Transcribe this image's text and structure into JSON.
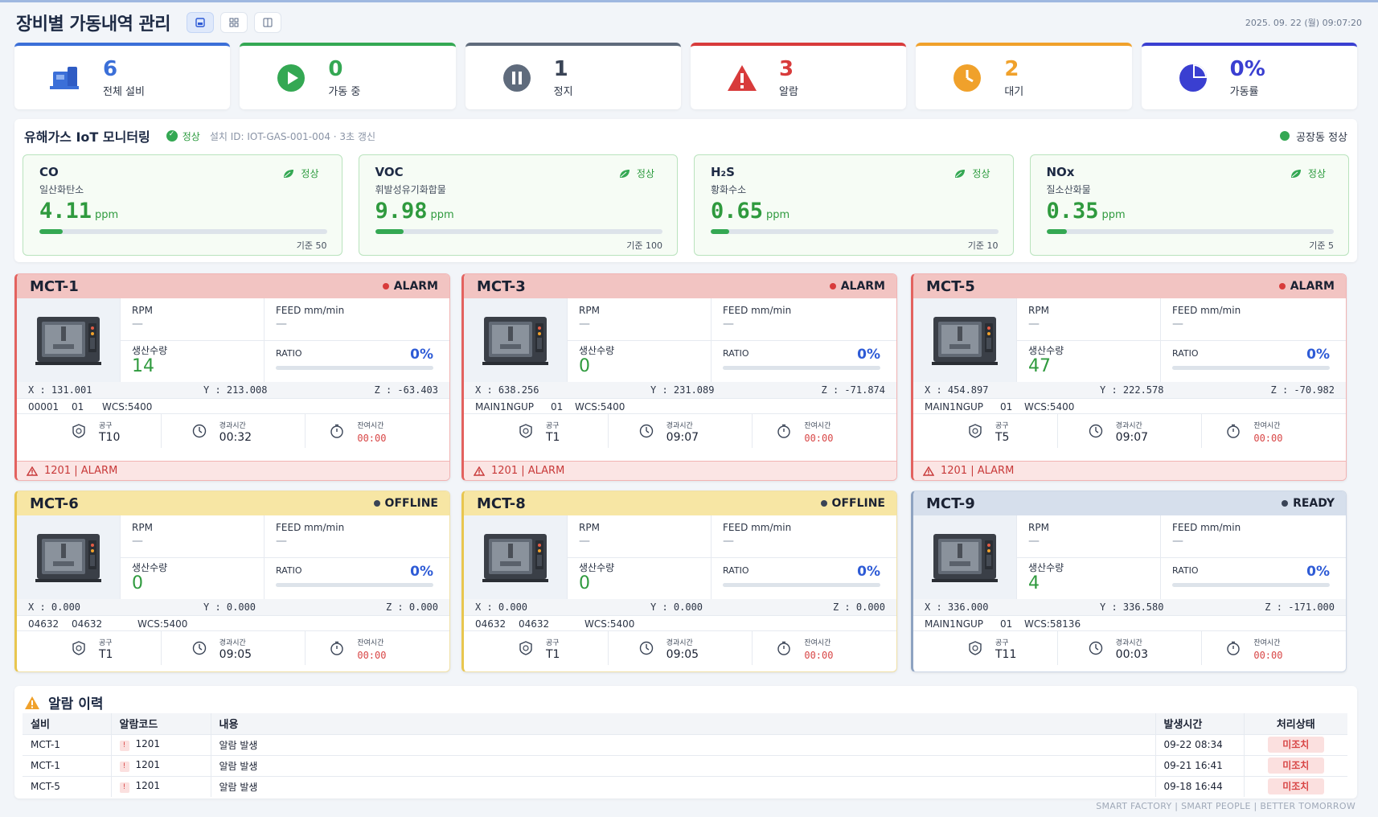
{
  "header": {
    "title": "장비별 가동내역 관리",
    "datetime": "2025. 09. 22 (월) 09:07:20",
    "view_buttons": [
      "card-view-icon",
      "grid-view-icon",
      "list-view-icon"
    ]
  },
  "stats": [
    {
      "value": "6",
      "label": "전체 설비",
      "color": "#3b6fd8",
      "icon": "machine-icon"
    },
    {
      "value": "0",
      "label": "가동 중",
      "color": "#34a853",
      "icon": "play-icon"
    },
    {
      "value": "1",
      "label": "정지",
      "color": "#5f6b7c",
      "icon": "pause-icon"
    },
    {
      "value": "3",
      "label": "알람",
      "color": "#d83b3b",
      "icon": "warning-icon"
    },
    {
      "value": "2",
      "label": "대기",
      "color": "#f0a12b",
      "icon": "clock-icon"
    },
    {
      "value": "0%",
      "label": "가동률",
      "color": "#3a3fd1",
      "icon": "pie-chart-icon"
    }
  ],
  "gas": {
    "title": "유해가스 IoT 모니터링",
    "status": "정상",
    "device": "설치 ID: IOT-GAS-001-004 · 3초 갱신",
    "factory_status": "공장동 정상",
    "sensors": [
      {
        "name": "CO",
        "sub": "일산화탄소",
        "value": "4.11",
        "unit": "ppm",
        "state": "정상",
        "limit": "기준 50",
        "fraction": 0.082
      },
      {
        "name": "VOC",
        "sub": "휘발성유기화합물",
        "value": "9.98",
        "unit": "ppm",
        "state": "정상",
        "limit": "기준 100",
        "fraction": 0.1
      },
      {
        "name": "H₂S",
        "sub": "황화수소",
        "value": "0.65",
        "unit": "ppm",
        "state": "정상",
        "limit": "기준 10",
        "fraction": 0.065
      },
      {
        "name": "NOx",
        "sub": "질소산화물",
        "value": "0.35",
        "unit": "ppm",
        "state": "정상",
        "limit": "기준 5",
        "fraction": 0.07
      }
    ]
  },
  "labels": {
    "rpm": "RPM",
    "feed": "FEED mm/min",
    "production": "생산수량",
    "ratio": "RATIO",
    "tool": "공구",
    "elapsed": "경과시간",
    "remaining": "잔여시간",
    "dash": "—"
  },
  "machines": [
    {
      "name": "MCT-1",
      "state": "ALARM",
      "production": "14",
      "ratio": "0%",
      "x": "X : 131.001",
      "y": "Y : 213.008",
      "z": "Z : -63.403",
      "prog1": "00001",
      "prog2": "01",
      "wcs": "WCS:5400",
      "tool": "T10",
      "elapsed": "00:32",
      "remaining": "00:00",
      "alarm": "1201 | ALARM"
    },
    {
      "name": "MCT-3",
      "state": "ALARM",
      "production": "0",
      "ratio": "0%",
      "x": "X : 638.256",
      "y": "Y : 231.089",
      "z": "Z : -71.874",
      "prog1": "MAIN1NGUP",
      "prog2": "01",
      "wcs": "WCS:5400",
      "tool": "T1",
      "elapsed": "09:07",
      "remaining": "00:00",
      "alarm": "1201 | ALARM"
    },
    {
      "name": "MCT-5",
      "state": "ALARM",
      "production": "47",
      "ratio": "0%",
      "x": "X : 454.897",
      "y": "Y : 222.578",
      "z": "Z : -70.982",
      "prog1": "MAIN1NGUP",
      "prog2": "01",
      "wcs": "WCS:5400",
      "tool": "T5",
      "elapsed": "09:07",
      "remaining": "00:00",
      "alarm": "1201 | ALARM"
    },
    {
      "name": "MCT-6",
      "state": "OFFLINE",
      "production": "0",
      "ratio": "0%",
      "x": "X : 0.000",
      "y": "Y : 0.000",
      "z": "Z : 0.000",
      "prog1": "04632",
      "prog2": "04632",
      "wcs": "WCS:5400",
      "tool": "T1",
      "elapsed": "09:05",
      "remaining": "00:00",
      "alarm": ""
    },
    {
      "name": "MCT-8",
      "state": "OFFLINE",
      "production": "0",
      "ratio": "0%",
      "x": "X : 0.000",
      "y": "Y : 0.000",
      "z": "Z : 0.000",
      "prog1": "04632",
      "prog2": "04632",
      "wcs": "WCS:5400",
      "tool": "T1",
      "elapsed": "09:05",
      "remaining": "00:00",
      "alarm": ""
    },
    {
      "name": "MCT-9",
      "state": "READY",
      "production": "4",
      "ratio": "0%",
      "x": "X : 336.000",
      "y": "Y : 336.580",
      "z": "Z : -171.000",
      "prog1": "MAIN1NGUP",
      "prog2": "01",
      "wcs": "WCS:58136",
      "tool": "T11",
      "elapsed": "00:03",
      "remaining": "00:00",
      "alarm": ""
    }
  ],
  "history": {
    "title": "알람 이력",
    "columns": [
      "설비",
      "알람코드",
      "내용",
      "발생시간",
      "처리상태"
    ],
    "rows": [
      {
        "machine": "MCT-1",
        "code": "1201",
        "content": "알람 발생",
        "time": "09-22 08:34",
        "status": "미조치"
      },
      {
        "machine": "MCT-1",
        "code": "1201",
        "content": "알람 발생",
        "time": "09-21 16:41",
        "status": "미조치"
      },
      {
        "machine": "MCT-5",
        "code": "1201",
        "content": "알람 발생",
        "time": "09-18 16:44",
        "status": "미조치"
      }
    ]
  },
  "footer": "SMART FACTORY   |   SMART PEOPLE   |   BETTER TOMORROW"
}
